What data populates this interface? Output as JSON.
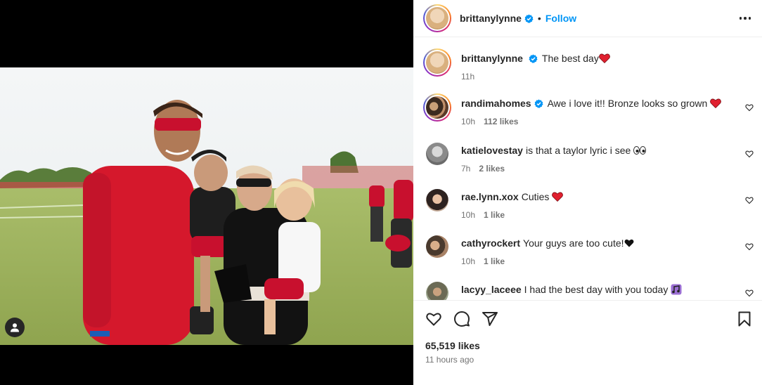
{
  "post": {
    "author": "brittanylynne",
    "follow_label": "Follow",
    "dot": "•",
    "caption": "The best day",
    "caption_time": "11h",
    "likes": "65,519 likes",
    "posted": "11 hours ago"
  },
  "comments": [
    {
      "user": "randimahomes",
      "verified": true,
      "text": "Awe i love it!! Bronze looks so grown",
      "emoji": "red-heart",
      "time": "10h",
      "likes": "112 likes"
    },
    {
      "user": "katielovestay",
      "verified": false,
      "text": "is that a taylor lyric i see",
      "emoji": "eyes",
      "time": "7h",
      "likes": "2 likes"
    },
    {
      "user": "rae.lynn.xox",
      "verified": false,
      "text": "Cuties",
      "emoji": "red-heart",
      "time": "10h",
      "likes": "1 like"
    },
    {
      "user": "cathyrockert",
      "verified": false,
      "text": "Your guys are too cute!",
      "emoji": "black-heart",
      "time": "10h",
      "likes": "1 like"
    },
    {
      "user": "lacyy_laceee",
      "verified": false,
      "text": "I had the best day with you today",
      "emoji": "music-notes",
      "time": "",
      "likes": ""
    }
  ],
  "icons": [
    "heart-icon",
    "comment-icon",
    "share-icon",
    "bookmark-icon",
    "more-options-icon",
    "user-tag-icon",
    "verified-icon"
  ],
  "colors": {
    "accent": "#0095f6",
    "verified": "#0095f6",
    "heart": "#ed4956",
    "text": "#262626",
    "muted": "#737373"
  }
}
